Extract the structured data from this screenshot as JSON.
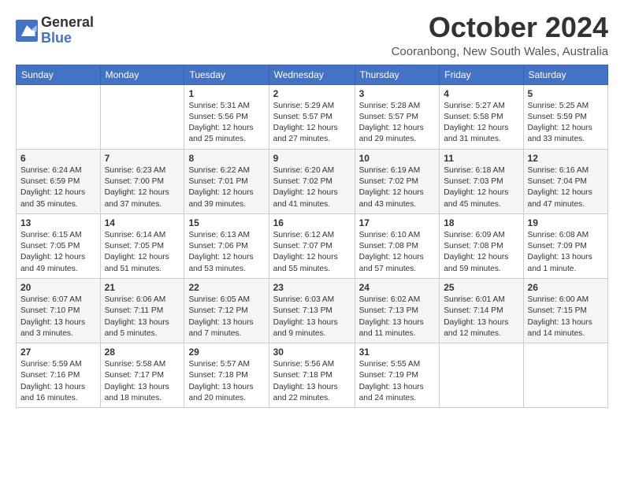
{
  "header": {
    "logo_line1": "General",
    "logo_line2": "Blue",
    "month": "October 2024",
    "location": "Cooranbong, New South Wales, Australia"
  },
  "days_of_week": [
    "Sunday",
    "Monday",
    "Tuesday",
    "Wednesday",
    "Thursday",
    "Friday",
    "Saturday"
  ],
  "weeks": [
    [
      {
        "day": "",
        "sunrise": "",
        "sunset": "",
        "daylight": ""
      },
      {
        "day": "",
        "sunrise": "",
        "sunset": "",
        "daylight": ""
      },
      {
        "day": "1",
        "sunrise": "Sunrise: 5:31 AM",
        "sunset": "Sunset: 5:56 PM",
        "daylight": "Daylight: 12 hours and 25 minutes."
      },
      {
        "day": "2",
        "sunrise": "Sunrise: 5:29 AM",
        "sunset": "Sunset: 5:57 PM",
        "daylight": "Daylight: 12 hours and 27 minutes."
      },
      {
        "day": "3",
        "sunrise": "Sunrise: 5:28 AM",
        "sunset": "Sunset: 5:57 PM",
        "daylight": "Daylight: 12 hours and 29 minutes."
      },
      {
        "day": "4",
        "sunrise": "Sunrise: 5:27 AM",
        "sunset": "Sunset: 5:58 PM",
        "daylight": "Daylight: 12 hours and 31 minutes."
      },
      {
        "day": "5",
        "sunrise": "Sunrise: 5:25 AM",
        "sunset": "Sunset: 5:59 PM",
        "daylight": "Daylight: 12 hours and 33 minutes."
      }
    ],
    [
      {
        "day": "6",
        "sunrise": "Sunrise: 6:24 AM",
        "sunset": "Sunset: 6:59 PM",
        "daylight": "Daylight: 12 hours and 35 minutes."
      },
      {
        "day": "7",
        "sunrise": "Sunrise: 6:23 AM",
        "sunset": "Sunset: 7:00 PM",
        "daylight": "Daylight: 12 hours and 37 minutes."
      },
      {
        "day": "8",
        "sunrise": "Sunrise: 6:22 AM",
        "sunset": "Sunset: 7:01 PM",
        "daylight": "Daylight: 12 hours and 39 minutes."
      },
      {
        "day": "9",
        "sunrise": "Sunrise: 6:20 AM",
        "sunset": "Sunset: 7:02 PM",
        "daylight": "Daylight: 12 hours and 41 minutes."
      },
      {
        "day": "10",
        "sunrise": "Sunrise: 6:19 AM",
        "sunset": "Sunset: 7:02 PM",
        "daylight": "Daylight: 12 hours and 43 minutes."
      },
      {
        "day": "11",
        "sunrise": "Sunrise: 6:18 AM",
        "sunset": "Sunset: 7:03 PM",
        "daylight": "Daylight: 12 hours and 45 minutes."
      },
      {
        "day": "12",
        "sunrise": "Sunrise: 6:16 AM",
        "sunset": "Sunset: 7:04 PM",
        "daylight": "Daylight: 12 hours and 47 minutes."
      }
    ],
    [
      {
        "day": "13",
        "sunrise": "Sunrise: 6:15 AM",
        "sunset": "Sunset: 7:05 PM",
        "daylight": "Daylight: 12 hours and 49 minutes."
      },
      {
        "day": "14",
        "sunrise": "Sunrise: 6:14 AM",
        "sunset": "Sunset: 7:05 PM",
        "daylight": "Daylight: 12 hours and 51 minutes."
      },
      {
        "day": "15",
        "sunrise": "Sunrise: 6:13 AM",
        "sunset": "Sunset: 7:06 PM",
        "daylight": "Daylight: 12 hours and 53 minutes."
      },
      {
        "day": "16",
        "sunrise": "Sunrise: 6:12 AM",
        "sunset": "Sunset: 7:07 PM",
        "daylight": "Daylight: 12 hours and 55 minutes."
      },
      {
        "day": "17",
        "sunrise": "Sunrise: 6:10 AM",
        "sunset": "Sunset: 7:08 PM",
        "daylight": "Daylight: 12 hours and 57 minutes."
      },
      {
        "day": "18",
        "sunrise": "Sunrise: 6:09 AM",
        "sunset": "Sunset: 7:08 PM",
        "daylight": "Daylight: 12 hours and 59 minutes."
      },
      {
        "day": "19",
        "sunrise": "Sunrise: 6:08 AM",
        "sunset": "Sunset: 7:09 PM",
        "daylight": "Daylight: 13 hours and 1 minute."
      }
    ],
    [
      {
        "day": "20",
        "sunrise": "Sunrise: 6:07 AM",
        "sunset": "Sunset: 7:10 PM",
        "daylight": "Daylight: 13 hours and 3 minutes."
      },
      {
        "day": "21",
        "sunrise": "Sunrise: 6:06 AM",
        "sunset": "Sunset: 7:11 PM",
        "daylight": "Daylight: 13 hours and 5 minutes."
      },
      {
        "day": "22",
        "sunrise": "Sunrise: 6:05 AM",
        "sunset": "Sunset: 7:12 PM",
        "daylight": "Daylight: 13 hours and 7 minutes."
      },
      {
        "day": "23",
        "sunrise": "Sunrise: 6:03 AM",
        "sunset": "Sunset: 7:13 PM",
        "daylight": "Daylight: 13 hours and 9 minutes."
      },
      {
        "day": "24",
        "sunrise": "Sunrise: 6:02 AM",
        "sunset": "Sunset: 7:13 PM",
        "daylight": "Daylight: 13 hours and 11 minutes."
      },
      {
        "day": "25",
        "sunrise": "Sunrise: 6:01 AM",
        "sunset": "Sunset: 7:14 PM",
        "daylight": "Daylight: 13 hours and 12 minutes."
      },
      {
        "day": "26",
        "sunrise": "Sunrise: 6:00 AM",
        "sunset": "Sunset: 7:15 PM",
        "daylight": "Daylight: 13 hours and 14 minutes."
      }
    ],
    [
      {
        "day": "27",
        "sunrise": "Sunrise: 5:59 AM",
        "sunset": "Sunset: 7:16 PM",
        "daylight": "Daylight: 13 hours and 16 minutes."
      },
      {
        "day": "28",
        "sunrise": "Sunrise: 5:58 AM",
        "sunset": "Sunset: 7:17 PM",
        "daylight": "Daylight: 13 hours and 18 minutes."
      },
      {
        "day": "29",
        "sunrise": "Sunrise: 5:57 AM",
        "sunset": "Sunset: 7:18 PM",
        "daylight": "Daylight: 13 hours and 20 minutes."
      },
      {
        "day": "30",
        "sunrise": "Sunrise: 5:56 AM",
        "sunset": "Sunset: 7:18 PM",
        "daylight": "Daylight: 13 hours and 22 minutes."
      },
      {
        "day": "31",
        "sunrise": "Sunrise: 5:55 AM",
        "sunset": "Sunset: 7:19 PM",
        "daylight": "Daylight: 13 hours and 24 minutes."
      },
      {
        "day": "",
        "sunrise": "",
        "sunset": "",
        "daylight": ""
      },
      {
        "day": "",
        "sunrise": "",
        "sunset": "",
        "daylight": ""
      }
    ]
  ]
}
